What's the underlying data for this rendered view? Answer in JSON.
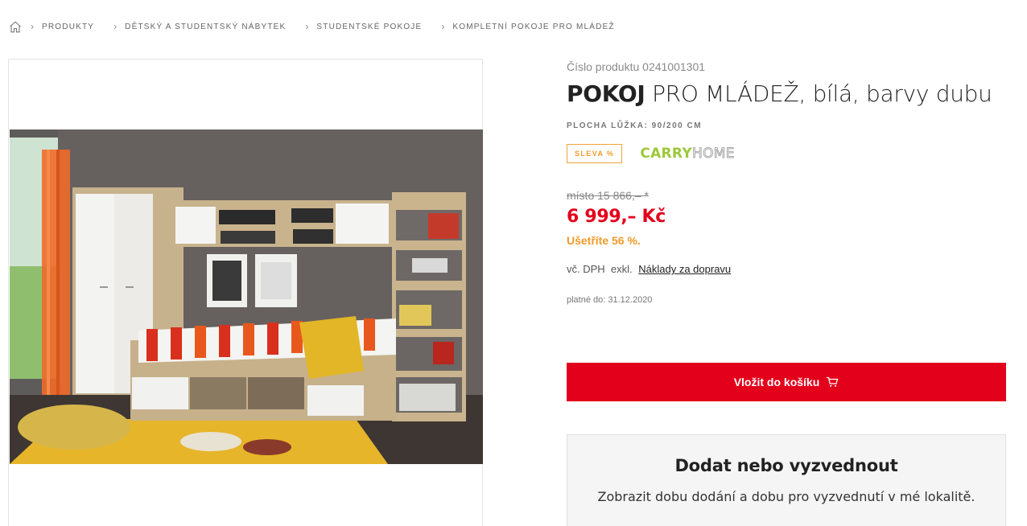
{
  "breadcrumb": {
    "items": [
      "PRODUKTY",
      "DĚTSKÝ A STUDENTSKÝ NÁBYTEK",
      "STUDENTSKÉ POKOJE",
      "KOMPLETNÍ POKOJE PRO MLÁDEŽ"
    ]
  },
  "product": {
    "number_label": "Číslo produktu 0241001301",
    "title_bold": "POKOJ",
    "title_rest": " PRO MLÁDEŽ, bílá, barvy dubu",
    "bed_size": "PLOCHA LŮŽKA: 90/200 CM",
    "sale_badge": "SLEVA %",
    "brand_part1": "CARRY",
    "brand_part2": "HOME",
    "old_price": "místo 15 866,– *",
    "price": "6 999,– Kč",
    "saving": "Ušetříte 56 %.",
    "vat_text": "vč. DPH  exkl.",
    "shipping_link": "Náklady za dopravu",
    "valid_until": "platné do: 31.12.2020",
    "cart_button": "Vložit do košíku"
  },
  "delivery": {
    "heading": "Dodat nebo vyzvednout",
    "text": "Zobrazit dobu dodání a dobu pro vyzvednutí v mé lokalitě."
  },
  "colors": {
    "accent_red": "#e3001b",
    "sale_orange": "#f19a2a",
    "brand_green": "#9cc83a"
  }
}
